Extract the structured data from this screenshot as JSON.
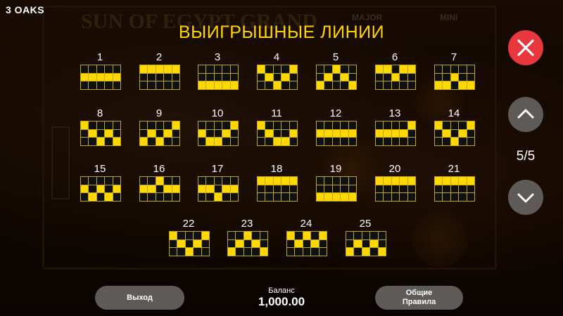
{
  "app": {
    "brand": "3 OAKS"
  },
  "background": {
    "logo": "SUN OF EGYPT GRAND",
    "major": "MAJOR",
    "mini": "MINI"
  },
  "title": "ВЫИГРЫШНЫЕ ЛИНИИ",
  "page_indicator": "5/5",
  "lines": [
    {
      "num": "1",
      "cells": [
        0,
        0,
        0,
        0,
        0,
        1,
        1,
        1,
        1,
        1,
        0,
        0,
        0,
        0,
        0
      ]
    },
    {
      "num": "2",
      "cells": [
        1,
        1,
        1,
        1,
        1,
        0,
        0,
        0,
        0,
        0,
        0,
        0,
        0,
        0,
        0
      ]
    },
    {
      "num": "3",
      "cells": [
        0,
        0,
        0,
        0,
        0,
        0,
        0,
        0,
        0,
        0,
        1,
        1,
        1,
        1,
        1
      ]
    },
    {
      "num": "4",
      "cells": [
        1,
        0,
        0,
        0,
        1,
        0,
        1,
        0,
        1,
        0,
        0,
        0,
        1,
        0,
        0
      ]
    },
    {
      "num": "5",
      "cells": [
        0,
        0,
        1,
        0,
        0,
        0,
        1,
        0,
        1,
        0,
        1,
        0,
        0,
        0,
        1
      ]
    },
    {
      "num": "6",
      "cells": [
        1,
        1,
        0,
        1,
        1,
        0,
        0,
        1,
        0,
        0,
        0,
        0,
        0,
        0,
        0
      ]
    },
    {
      "num": "7",
      "cells": [
        0,
        0,
        0,
        0,
        0,
        0,
        0,
        1,
        0,
        0,
        1,
        1,
        0,
        1,
        1
      ]
    },
    {
      "num": "8",
      "cells": [
        1,
        0,
        0,
        0,
        0,
        0,
        1,
        0,
        1,
        0,
        0,
        0,
        1,
        0,
        1
      ]
    },
    {
      "num": "9",
      "cells": [
        0,
        0,
        0,
        0,
        1,
        0,
        1,
        0,
        1,
        0,
        1,
        0,
        1,
        0,
        0
      ]
    },
    {
      "num": "10",
      "cells": [
        0,
        0,
        0,
        0,
        1,
        1,
        0,
        0,
        1,
        0,
        0,
        1,
        1,
        0,
        0
      ]
    },
    {
      "num": "11",
      "cells": [
        1,
        0,
        0,
        0,
        0,
        0,
        1,
        0,
        0,
        1,
        0,
        0,
        1,
        1,
        0
      ]
    },
    {
      "num": "12",
      "cells": [
        0,
        0,
        0,
        0,
        0,
        1,
        1,
        1,
        1,
        1,
        0,
        0,
        0,
        0,
        0
      ]
    },
    {
      "num": "13",
      "cells": [
        0,
        0,
        0,
        0,
        1,
        1,
        1,
        1,
        1,
        0,
        0,
        0,
        0,
        0,
        0
      ]
    },
    {
      "num": "14",
      "cells": [
        1,
        0,
        0,
        0,
        1,
        0,
        1,
        0,
        1,
        0,
        0,
        0,
        1,
        0,
        0
      ]
    },
    {
      "num": "15",
      "cells": [
        0,
        0,
        0,
        0,
        0,
        1,
        0,
        1,
        0,
        1,
        0,
        1,
        0,
        1,
        0
      ]
    },
    {
      "num": "16",
      "cells": [
        0,
        0,
        1,
        0,
        0,
        1,
        1,
        0,
        1,
        1,
        0,
        0,
        0,
        0,
        0
      ]
    },
    {
      "num": "17",
      "cells": [
        0,
        0,
        0,
        0,
        0,
        1,
        1,
        0,
        1,
        1,
        0,
        0,
        1,
        0,
        0
      ]
    },
    {
      "num": "18",
      "cells": [
        1,
        1,
        1,
        1,
        1,
        0,
        0,
        0,
        0,
        0,
        0,
        0,
        0,
        0,
        0
      ]
    },
    {
      "num": "19",
      "cells": [
        0,
        0,
        0,
        0,
        0,
        0,
        0,
        0,
        0,
        0,
        1,
        1,
        1,
        1,
        1
      ]
    },
    {
      "num": "20",
      "cells": [
        1,
        1,
        1,
        1,
        1,
        0,
        0,
        0,
        0,
        0,
        0,
        0,
        0,
        0,
        0
      ]
    },
    {
      "num": "21",
      "cells": [
        1,
        1,
        1,
        1,
        1,
        0,
        0,
        0,
        0,
        0,
        0,
        0,
        0,
        0,
        0
      ]
    },
    {
      "num": "22",
      "cells": [
        1,
        0,
        0,
        0,
        1,
        0,
        1,
        0,
        1,
        0,
        0,
        0,
        1,
        0,
        0
      ]
    },
    {
      "num": "23",
      "cells": [
        0,
        0,
        1,
        0,
        0,
        0,
        1,
        0,
        1,
        0,
        1,
        0,
        0,
        0,
        1
      ]
    },
    {
      "num": "24",
      "cells": [
        1,
        0,
        1,
        0,
        1,
        0,
        1,
        0,
        1,
        0,
        0,
        0,
        0,
        0,
        0
      ]
    },
    {
      "num": "25",
      "cells": [
        0,
        0,
        0,
        0,
        0,
        0,
        1,
        0,
        1,
        0,
        1,
        0,
        1,
        0,
        1
      ]
    }
  ],
  "footer": {
    "exit_label": "Выход",
    "balance_label": "Баланс",
    "balance_value": "1,000.00",
    "rules_label": "Общие\nПравила"
  },
  "icons": {
    "close": "close-icon",
    "up": "chevron-up-icon",
    "down": "chevron-down-icon"
  },
  "colors": {
    "accent": "#ffd400",
    "close_button": "#e8373d",
    "nav_button": "#5d5a57",
    "cell_on": "#ffd800",
    "cell_off": "#111111",
    "grid_border": "#bca61f"
  }
}
